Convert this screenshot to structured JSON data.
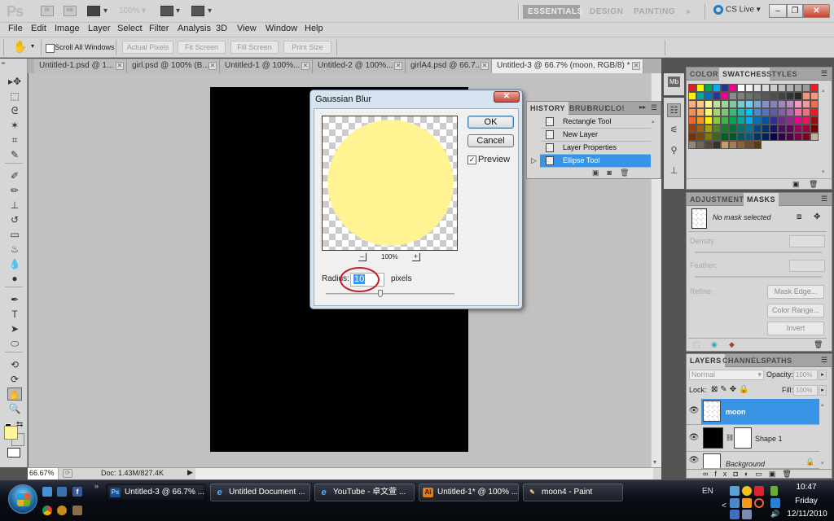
{
  "app": {
    "logo": "Ps",
    "zoom_display": "100%",
    "workspaces": [
      "ESSENTIALS",
      "DESIGN",
      "PAINTING"
    ],
    "more_workspaces": "»",
    "cs_live": "CS Live ▾",
    "window_controls": {
      "minimize": "–",
      "restore": "❐",
      "close": "✕"
    }
  },
  "menu": [
    "File",
    "Edit",
    "Image",
    "Layer",
    "Select",
    "Filter",
    "Analysis",
    "3D",
    "View",
    "Window",
    "Help"
  ],
  "options_bar": {
    "tool_icon": "hand-icon",
    "scroll_all_windows": "Scroll All Windows",
    "scroll_all_checked": false,
    "buttons": [
      "Actual Pixels",
      "Fit Screen",
      "Fill Screen",
      "Print Size"
    ]
  },
  "doc_tabs": [
    {
      "label": "Untitled-1.psd @ 1...",
      "active": false
    },
    {
      "label": "girl.psd @ 100% (B...",
      "active": false
    },
    {
      "label": "Untitled-1 @ 100%...",
      "active": false
    },
    {
      "label": "Untitled-2 @ 100%...",
      "active": false
    },
    {
      "label": "girlA4.psd @ 66.7...",
      "active": false
    },
    {
      "label": "Untitled-3 @ 66.7% (moon, RGB/8) *",
      "active": true
    }
  ],
  "tools": [
    "move",
    "marquee",
    "lasso",
    "quick-select",
    "crop",
    "eyedropper",
    "healing-brush",
    "brush",
    "clone-stamp",
    "history-brush",
    "eraser",
    "paint-bucket",
    "blur",
    "dodge",
    "pen",
    "type",
    "path-select",
    "ellipse-shape",
    "3d-rotate",
    "3d-orbit",
    "hand",
    "zoom"
  ],
  "tool_glyphs": [
    "▸✥",
    "⬚",
    "ᘓ",
    "✶",
    "⌗",
    "✎",
    "✐",
    "✏",
    "⊥",
    "↺",
    "▭",
    "♨",
    "💧",
    "●",
    "✒",
    "T",
    "➤",
    "⬭",
    "⟲",
    "⟳",
    "✋",
    "🔍"
  ],
  "active_tool": "hand",
  "colors": {
    "foreground": "#fff799",
    "background": "#ffffff",
    "accent": "#3994e5"
  },
  "dialog": {
    "title": "Gaussian Blur",
    "close": "✕",
    "ok": "OK",
    "cancel": "Cancel",
    "preview_label": "Preview",
    "preview_checked": true,
    "zoom_out": "–",
    "zoom_in": "+",
    "zoom_level": "100%",
    "radius_label": "Radius:",
    "radius_value": "10",
    "radius_unit": "pixels",
    "radius_slider_fraction": 0.42
  },
  "history": {
    "tabs": [
      "HISTORY",
      "BRU!",
      "BRU!",
      "CLO!"
    ],
    "items": [
      {
        "label": "Rectangle Tool",
        "selected": false
      },
      {
        "label": "New Layer",
        "selected": false
      },
      {
        "label": "Layer Properties",
        "selected": false
      },
      {
        "label": "Ellipse Tool",
        "selected": true
      }
    ]
  },
  "swatches_panel": {
    "tabs": [
      "COLOR",
      "SWATCHES",
      "STYLES"
    ],
    "active_tab": "SWATCHES",
    "rows": [
      [
        "#e11b22",
        "#fff200",
        "#00a651",
        "#00aeef",
        "#2e3192",
        "#ec008c",
        "#ffffff",
        "#f2f2f2",
        "#e6e6e6",
        "#d9d9d9",
        "#cccccc",
        "#bfbfbf",
        "#b3b3b3",
        "#a6a6a6",
        "#999999",
        "#ed1c24"
      ],
      [
        "#fff200",
        "#00a99d",
        "#0072bc",
        "#2e3192",
        "#ec008c",
        "#8c8c8c",
        "#808080",
        "#737373",
        "#666666",
        "#595959",
        "#4d4d4d",
        "#404040",
        "#333333",
        "#262626",
        "#f69679",
        "#f7977a"
      ],
      [
        "#f9ad81",
        "#fdc68a",
        "#fff79a",
        "#c4df9b",
        "#a3d39c",
        "#82ca9d",
        "#7accc8",
        "#6dcff6",
        "#7da7d9",
        "#8393ca",
        "#8781bd",
        "#a187be",
        "#bd8cbf",
        "#f49ac1",
        "#f5989d",
        "#f26c4f"
      ],
      [
        "#f68e56",
        "#fbaf5d",
        "#fff568",
        "#acd373",
        "#7cc576",
        "#3cb878",
        "#1cbbb4",
        "#00bff3",
        "#448ccb",
        "#5674b9",
        "#605ca8",
        "#855fa8",
        "#a864a8",
        "#f06eaa",
        "#f26d7d",
        "#ed1c24"
      ],
      [
        "#f26522",
        "#f7941d",
        "#fff200",
        "#8dc63f",
        "#39b54a",
        "#00a651",
        "#00a99d",
        "#00aeef",
        "#0072bc",
        "#0054a6",
        "#2e3192",
        "#662d91",
        "#92278f",
        "#ec008c",
        "#ed145b",
        "#9e0b0f"
      ],
      [
        "#a0410d",
        "#a36209",
        "#aba000",
        "#598527",
        "#197b30",
        "#007236",
        "#00746b",
        "#0076a3",
        "#004a80",
        "#003471",
        "#1b1464",
        "#440e62",
        "#630460",
        "#9e005d",
        "#9e0039",
        "#790000"
      ],
      [
        "#7b2e00",
        "#7d4900",
        "#827b00",
        "#406618",
        "#005e20",
        "#005826",
        "#005952",
        "#005b7f",
        "#003663",
        "#002157",
        "#0d004c",
        "#32004b",
        "#4b0049",
        "#7b0046",
        "#7a0026",
        "#c7b299"
      ],
      [
        "#998675",
        "#736357",
        "#534741",
        "#37302d",
        "#c69c6d",
        "#a67c52",
        "#8c6239",
        "#754c24",
        "#603913"
      ]
    ]
  },
  "masks_panel": {
    "tabs": [
      "ADJUSTMENTS",
      "MASKS"
    ],
    "active_tab": "MASKS",
    "status": "No mask selected",
    "density_label": "Density:",
    "feather_label": "Feather:",
    "refine_label": "Refine:",
    "buttons": [
      "Mask Edge...",
      "Color Range...",
      "Invert"
    ]
  },
  "layers_panel": {
    "tabs": [
      "LAYERS",
      "CHANNELS",
      "PATHS"
    ],
    "active_tab": "LAYERS",
    "blend_mode": "Normal",
    "opacity_label": "Opacity:",
    "opacity_value": "100%",
    "lock_label": "Lock:",
    "fill_label": "Fill:",
    "fill_value": "100%",
    "layers": [
      {
        "name": "moon",
        "selected": true,
        "visible": true,
        "locked": false
      },
      {
        "name": "Shape 1",
        "selected": false,
        "visible": true,
        "locked": false
      },
      {
        "name": "Background",
        "selected": false,
        "visible": true,
        "locked": true
      }
    ],
    "footer_icons": [
      "link-icon",
      "fx-icon",
      "add-mask-icon",
      "adjustment-layer-icon",
      "group-icon",
      "new-layer-icon",
      "trash-icon"
    ]
  },
  "status_bar": {
    "zoom": "66.67%",
    "doc_info": "Doc: 1.43M/827.4K"
  },
  "taskbar": {
    "buttons": [
      {
        "label": "Untitled-3 @ 66.7% ...",
        "app": "Ps",
        "active": true
      },
      {
        "label": "Untitled Document ...",
        "app": "e",
        "active": false
      },
      {
        "label": "YouTube - 卓文萱 ...",
        "app": "e",
        "active": false
      },
      {
        "label": "Untitled-1* @ 100% ...",
        "app": "Ai",
        "active": false
      },
      {
        "label": "moon4 - Paint",
        "app": "✎",
        "active": false
      }
    ],
    "language": "EN",
    "time": "10:47",
    "day": "Friday",
    "date": "12/11/2010",
    "quick_launch_more": "»",
    "tray_expand": "<"
  }
}
